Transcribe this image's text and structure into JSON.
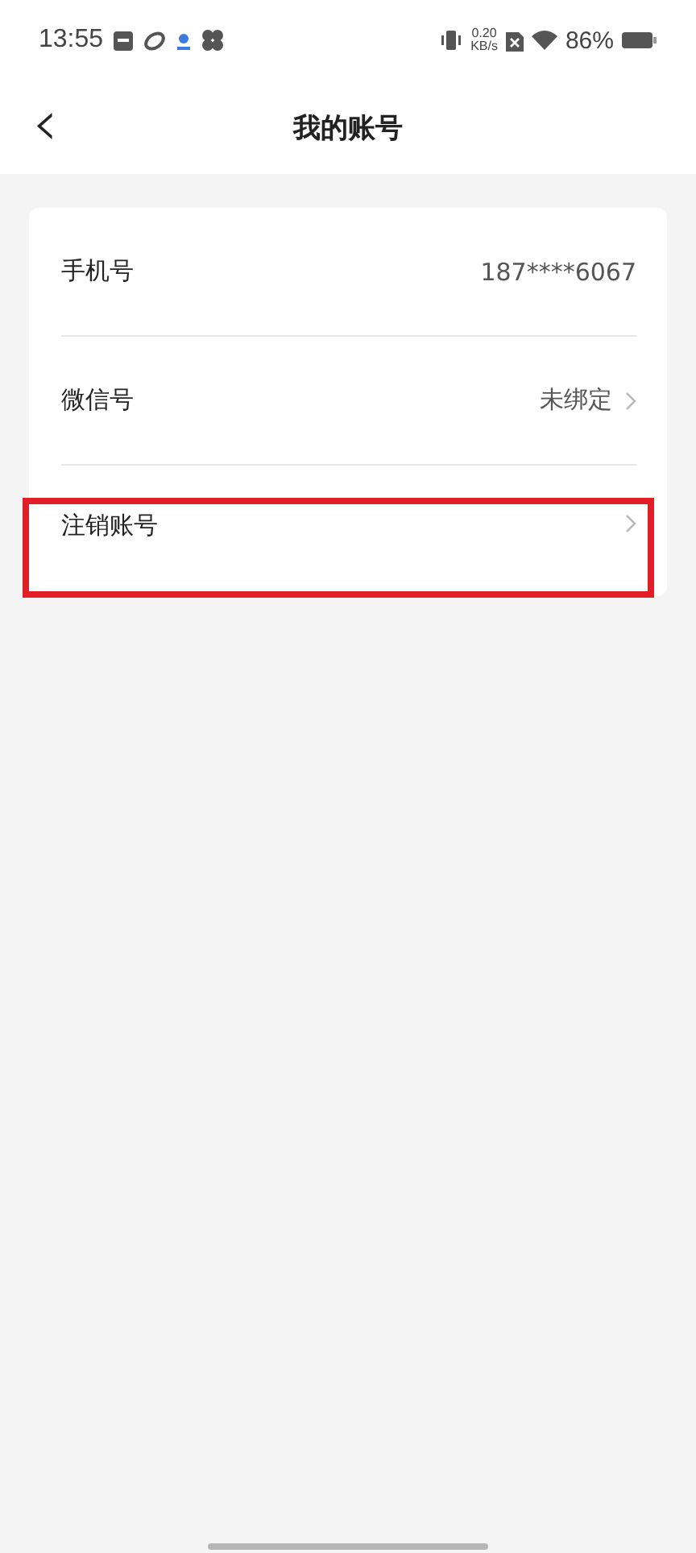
{
  "status_bar": {
    "time": "13:55",
    "speed": "0.20",
    "speed_unit": "KB/s",
    "battery": "86%"
  },
  "header": {
    "back": "‹",
    "title": "我的账号"
  },
  "rows": [
    {
      "label": "手机号",
      "value": "187****6067",
      "chevron": false,
      "highlighted": false
    },
    {
      "label": "微信号",
      "value": "未绑定",
      "chevron": true,
      "highlighted": false
    },
    {
      "label": "注销账号",
      "chevron": true,
      "highlighted": true
    }
  ]
}
